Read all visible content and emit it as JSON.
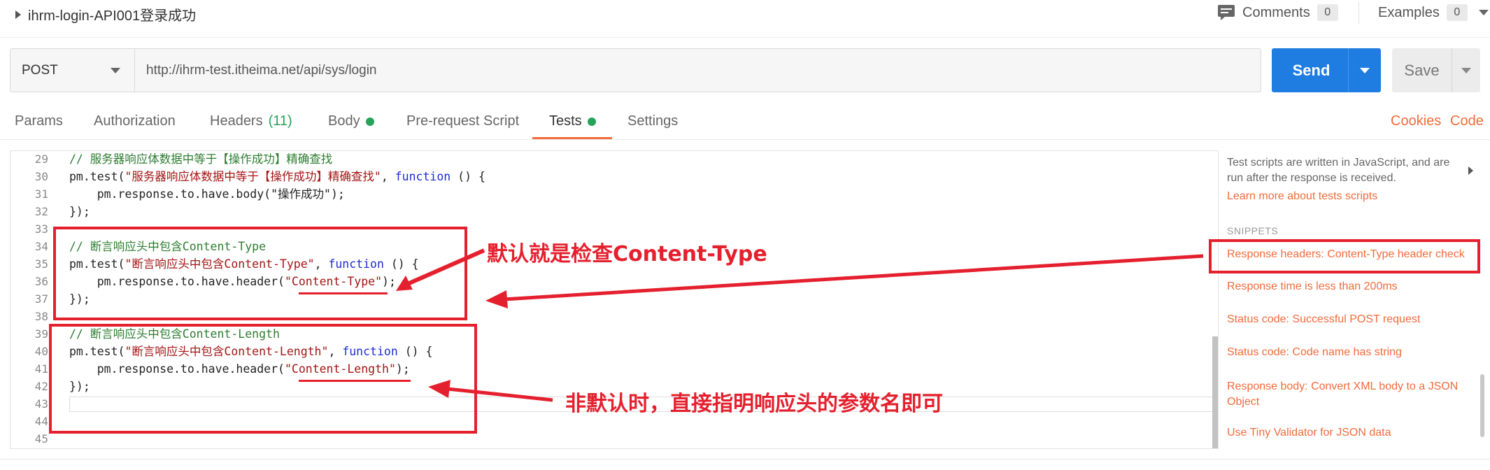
{
  "header": {
    "request_name": "ihrm-login-API001登录成功",
    "comments_label": "Comments",
    "comments_count": "0",
    "examples_label": "Examples",
    "examples_count": "0"
  },
  "request": {
    "method": "POST",
    "url": "http://ihrm-test.itheima.net/api/sys/login",
    "send_label": "Send",
    "save_label": "Save"
  },
  "tabs": [
    {
      "label": "Params"
    },
    {
      "label": "Authorization"
    },
    {
      "label": "Headers",
      "count": "(11)"
    },
    {
      "label": "Body"
    },
    {
      "label": "Pre-request Script"
    },
    {
      "label": "Tests"
    },
    {
      "label": "Settings"
    }
  ],
  "links": {
    "cookies": "Cookies",
    "code": "Code"
  },
  "editor": {
    "lines": [
      {
        "n": "29",
        "text": "// 服务器响应体数据中等于【操作成功】精确查找"
      },
      {
        "n": "30",
        "p1": "pm.test(",
        "s": "\"服务器响应体数据中等于【操作成功】精确查找\"",
        "p2": ", ",
        "kw": "function",
        "p3": " () {"
      },
      {
        "n": "31",
        "text": "    pm.response.to.have.body(\"操作成功\");"
      },
      {
        "n": "32",
        "text": "});"
      },
      {
        "n": "33",
        "text": ""
      },
      {
        "n": "34",
        "text": "// 断言响应头中包含Content-Type"
      },
      {
        "n": "35",
        "p1": "pm.test(",
        "s": "\"断言响应头中包含Content-Type\"",
        "p2": ", ",
        "kw": "function",
        "p3": " () {"
      },
      {
        "n": "36",
        "a": "    pm.response.to.have.header(",
        "s": "\"Content-Type\"",
        "b": ");"
      },
      {
        "n": "37",
        "text": "});"
      },
      {
        "n": "38",
        "text": ""
      },
      {
        "n": "39",
        "text": "// 断言响应头中包含Content-Length"
      },
      {
        "n": "40",
        "p1": "pm.test(",
        "s": "\"断言响应头中包含Content-Length\"",
        "p2": ", ",
        "kw": "function",
        "p3": " () {"
      },
      {
        "n": "41",
        "a": "    pm.response.to.have.header(",
        "s": "\"Content-Length\"",
        "b": ");"
      },
      {
        "n": "42",
        "text": "});"
      },
      {
        "n": "43",
        "text": ""
      },
      {
        "n": "44",
        "text": ""
      },
      {
        "n": "45",
        "text": ""
      }
    ]
  },
  "sidebar": {
    "description": "Test scripts are written in JavaScript, and are run after the response is received.",
    "learn_more": "Learn more about tests scripts",
    "snippets_header": "SNIPPETS",
    "snippets": [
      "Response headers: Content-Type header check",
      "Response time is less than 200ms",
      "Status code: Successful POST request",
      "Status code: Code name has string",
      "Response body: Convert XML body to a JSON Object",
      "Use Tiny Validator for JSON data"
    ]
  },
  "annotations": {
    "default_note": "默认就是检查Content-Type",
    "non_default_note": "非默认时，直接指明响应头的参数名即可"
  },
  "colors": {
    "accent": "#f26b3a",
    "send": "#1f7ce0",
    "annotation_red": "#e5202e",
    "status_green": "#27a35a"
  }
}
